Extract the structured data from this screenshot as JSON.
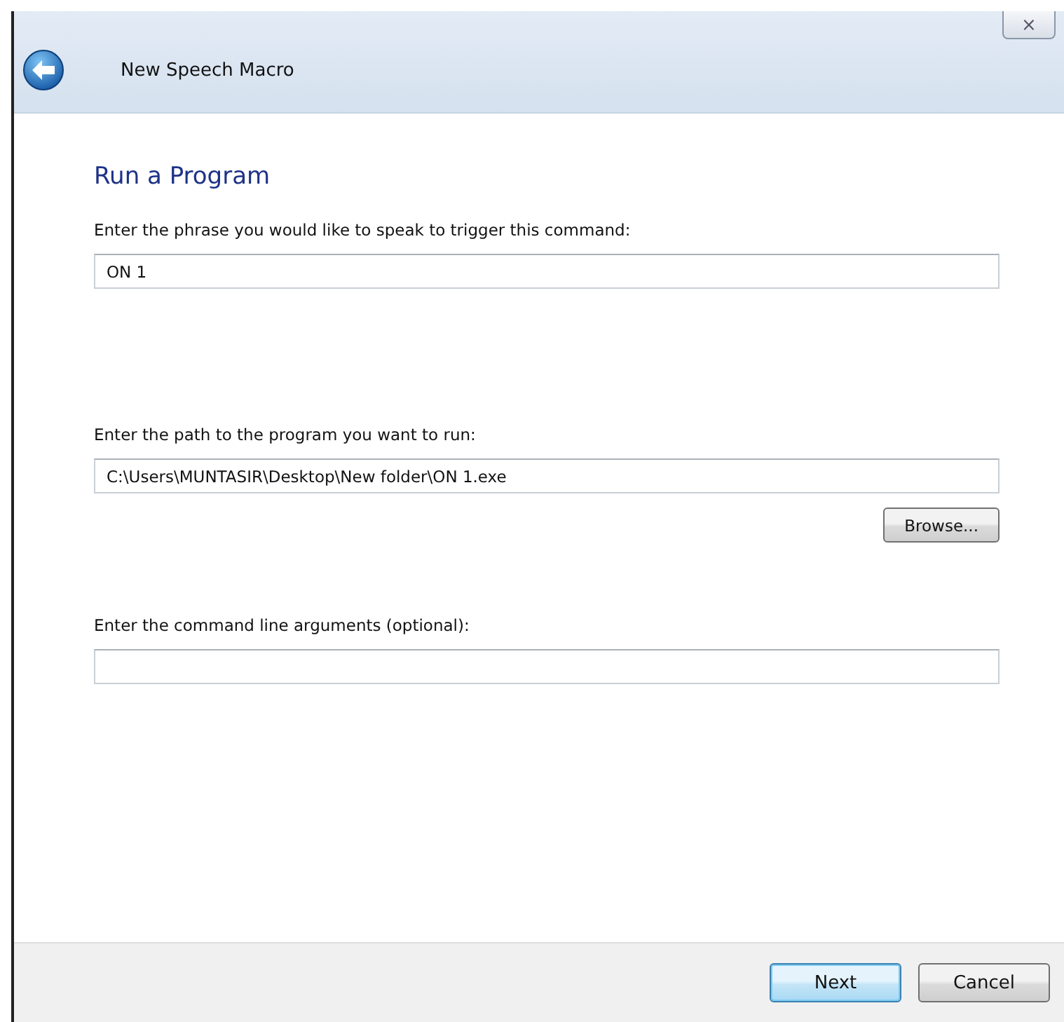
{
  "window": {
    "title": "New Speech Macro",
    "close": "⨯"
  },
  "page_title": "Run a Program",
  "fields": [
    {
      "label": "Enter the phrase you would like to speak to trigger this command:",
      "value": "ON 1"
    },
    {
      "label": "Enter the path to the program you want to run:",
      "value": "C:\\Users\\MUNTASIR\\Desktop\\New folder\\ON 1.exe",
      "button": "Browse..."
    },
    {
      "label": "Enter the command line arguments (optional):"
    }
  ],
  "buttons": [
    {
      "label": "Next",
      "default": true
    },
    {
      "label": "Cancel",
      "default": false
    }
  ]
}
